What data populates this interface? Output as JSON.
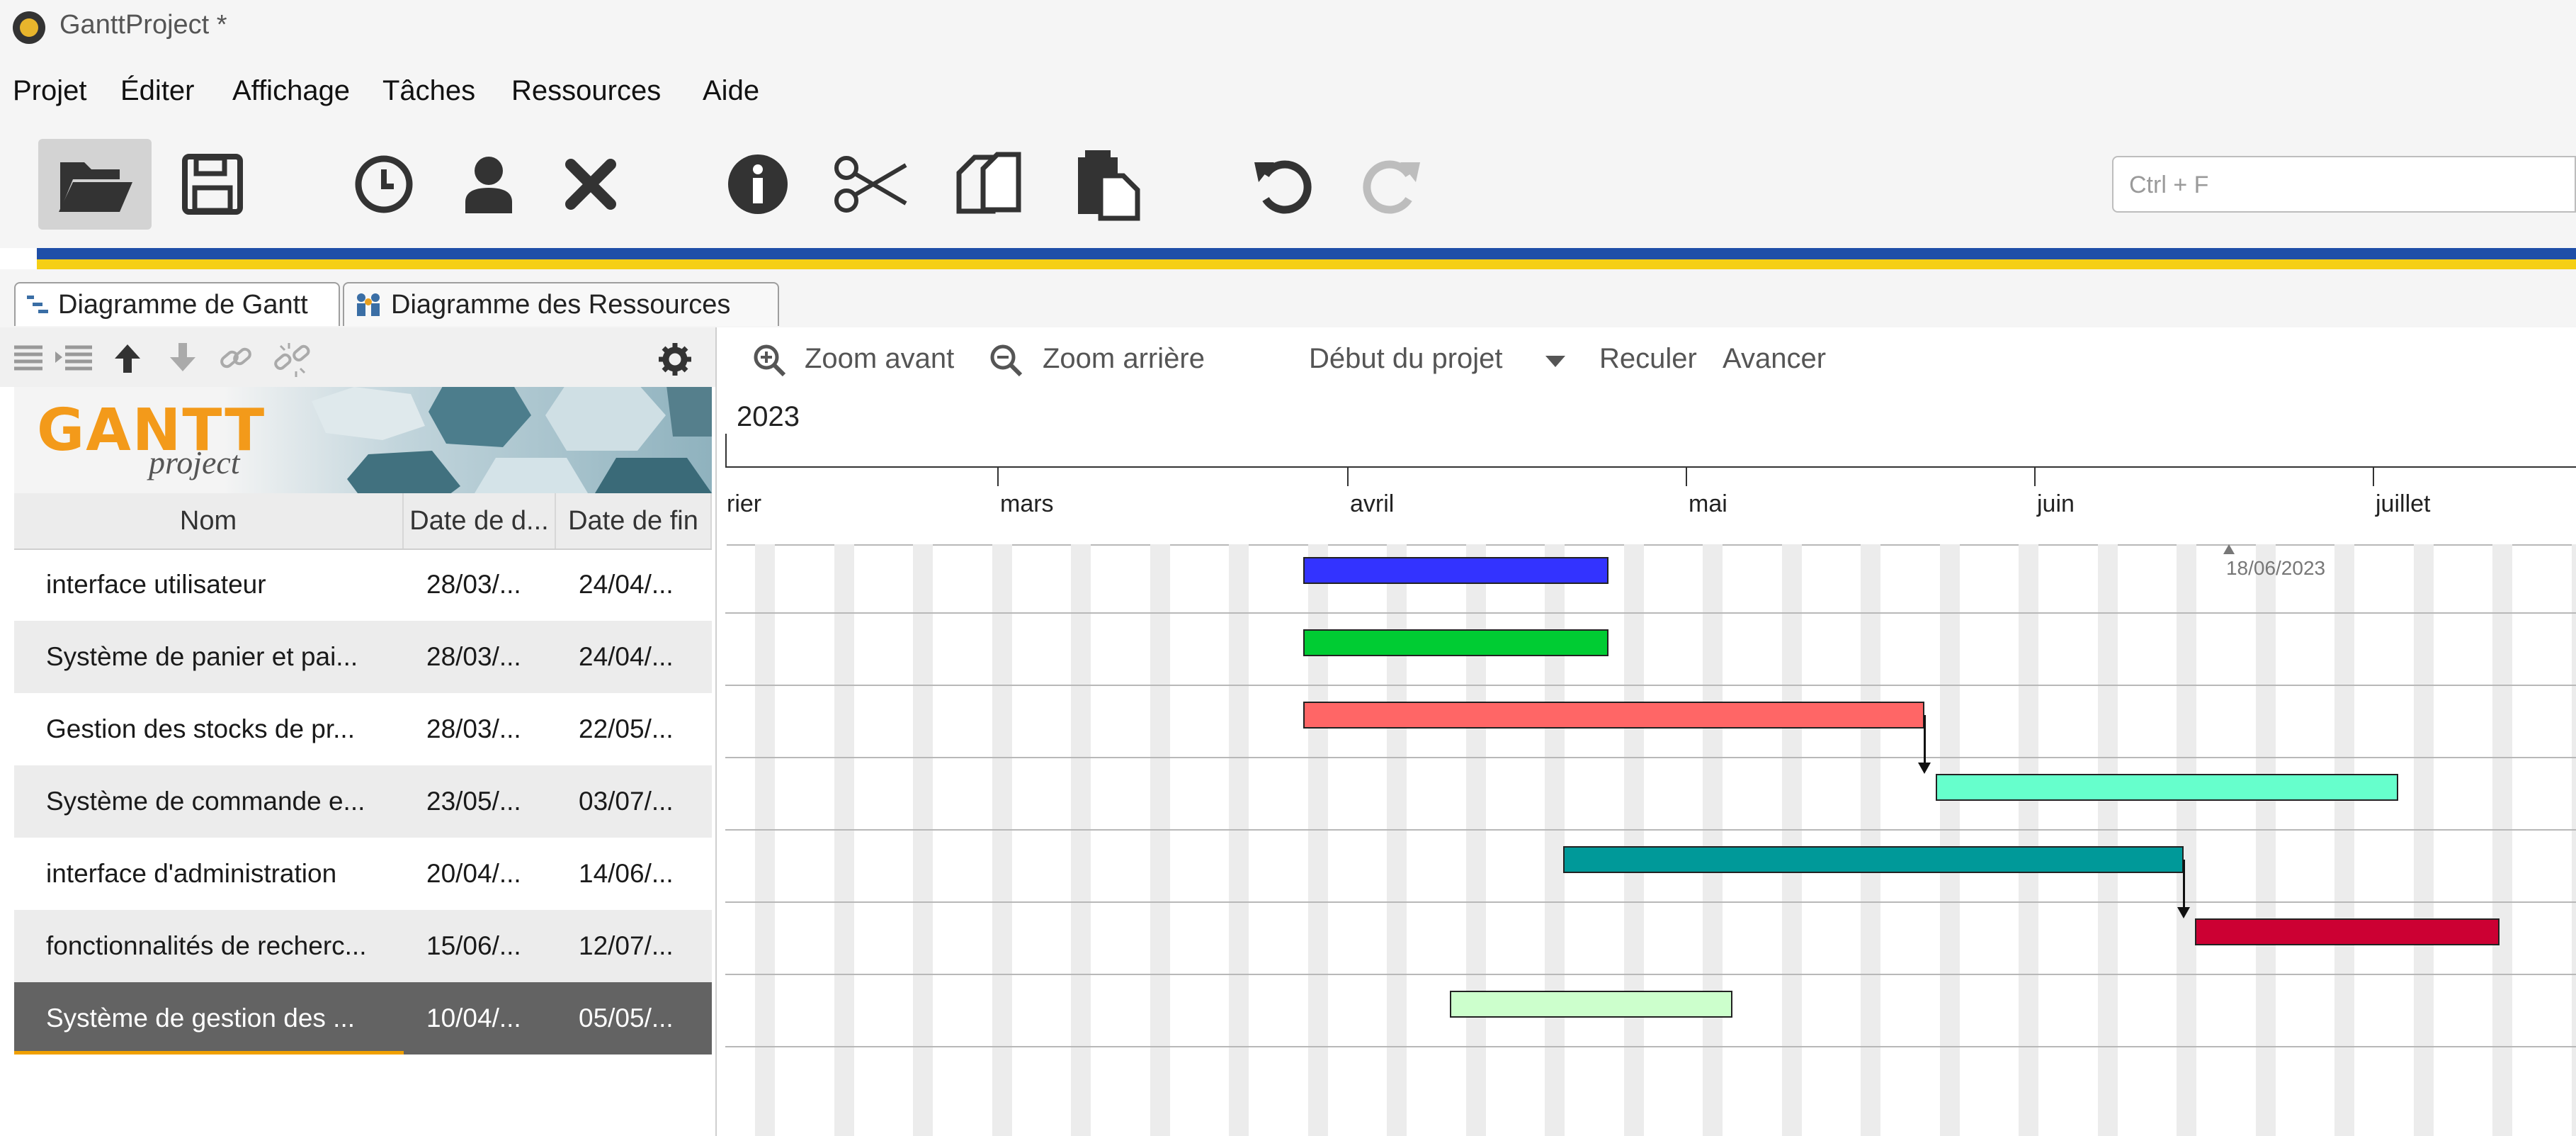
{
  "app": {
    "title": "GanttProject *"
  },
  "menu": [
    "Projet",
    "Éditer",
    "Affichage",
    "Tâches",
    "Ressources",
    "Aide"
  ],
  "toolbar": {
    "icons": [
      "open-folder-icon",
      "save-icon",
      "clock-icon",
      "user-icon",
      "delete-icon",
      "info-icon",
      "cut-icon",
      "copy-icon",
      "paste-icon",
      "undo-icon",
      "redo-icon"
    ],
    "search_placeholder": "Ctrl + F"
  },
  "tabs": [
    {
      "label": "Diagramme de Gantt"
    },
    {
      "label": "Diagramme des Ressources"
    }
  ],
  "logo": {
    "word1": "GANTT",
    "word2": "project"
  },
  "table": {
    "headers": [
      "Nom",
      "Date de d...",
      "Date de fin"
    ],
    "rows": [
      {
        "name": "interface utilisateur",
        "start": "28/03/...",
        "end": "24/04/..."
      },
      {
        "name": "Système de panier et pai...",
        "start": "28/03/...",
        "end": "24/04/..."
      },
      {
        "name": "Gestion des stocks de pr...",
        "start": "28/03/...",
        "end": "22/05/..."
      },
      {
        "name": "Système de commande e...",
        "start": "23/05/...",
        "end": "03/07/..."
      },
      {
        "name": "interface d'administration",
        "start": "20/04/...",
        "end": "14/06/..."
      },
      {
        "name": "fonctionnalités de recherc...",
        "start": "15/06/...",
        "end": "12/07/..."
      },
      {
        "name": "Système de gestion des ...",
        "start": "10/04/...",
        "end": "05/05/..."
      }
    ],
    "selected_index": 6
  },
  "chart_toolbar": {
    "zoom_in": "Zoom avant",
    "zoom_out": "Zoom arrière",
    "project_start": "Début du projet",
    "back": "Reculer",
    "forward": "Avancer"
  },
  "timeline": {
    "year": "2023",
    "months": [
      "rier",
      "mars",
      "avril",
      "mai",
      "juin",
      "juillet"
    ],
    "today": "18/06/2023"
  },
  "bars": [
    {
      "task": "interface utilisateur",
      "start": "2023-03-28",
      "end": "2023-04-24",
      "color": "#3333ff"
    },
    {
      "task": "Système de panier et pai...",
      "start": "2023-03-28",
      "end": "2023-04-24",
      "color": "#00cc33"
    },
    {
      "task": "Gestion des stocks de pr...",
      "start": "2023-03-28",
      "end": "2023-05-22",
      "color": "#ff6666"
    },
    {
      "task": "Système de commande e...",
      "start": "2023-05-23",
      "end": "2023-07-03",
      "color": "#66ffcc"
    },
    {
      "task": "interface d'administration",
      "start": "2023-04-20",
      "end": "2023-06-14",
      "color": "#009999"
    },
    {
      "task": "fonctionnalités de recherc...",
      "start": "2023-06-15",
      "end": "2023-07-12",
      "color": "#cc0033"
    },
    {
      "task": "Système de gestion des ...",
      "start": "2023-04-10",
      "end": "2023-05-05",
      "color": "#ccffcc"
    }
  ],
  "dependencies": [
    {
      "from": 2,
      "to": 3
    },
    {
      "from": 4,
      "to": 5
    }
  ]
}
